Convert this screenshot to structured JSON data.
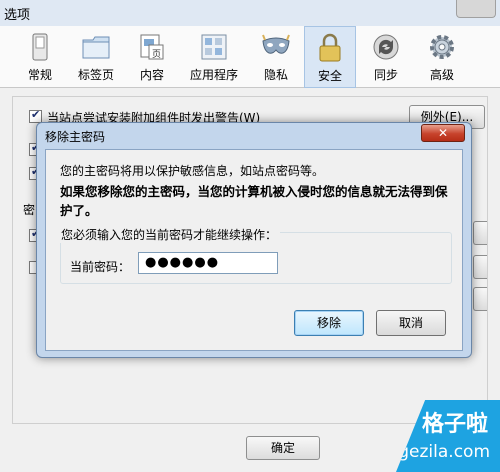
{
  "window": {
    "title": "选项"
  },
  "toolbar": {
    "items": [
      {
        "label": "常规",
        "icon": "switch-icon"
      },
      {
        "label": "标签页",
        "icon": "tabs-folder-icon"
      },
      {
        "label": "内容",
        "icon": "content-page-icon"
      },
      {
        "label": "应用程序",
        "icon": "applications-icon"
      },
      {
        "label": "隐私",
        "icon": "mask-icon"
      },
      {
        "label": "安全",
        "icon": "padlock-icon",
        "selected": true
      },
      {
        "label": "同步",
        "icon": "sync-icon"
      },
      {
        "label": "高级",
        "icon": "gear-icon"
      }
    ]
  },
  "main": {
    "addon_warning_label": "当站点尝试安装附加组件时发出警告(W)",
    "exceptions_button": "例外(E)...",
    "passwords_group_fragment": "密",
    "ok_button": "确定"
  },
  "dialog": {
    "title": "移除主密码",
    "close_symbol": "✕",
    "info_text": "您的主密码将用以保护敏感信息，如站点密码等。",
    "warning_text": "如果您移除您的主密码，当您的计算机被入侵时您的信息就无法得到保护了。",
    "group_label": "您必须输入您的当前密码才能继续操作：",
    "password_label": "当前密码：",
    "password_value": "●●●●●●",
    "remove_button": "移除",
    "cancel_button": "取消"
  },
  "watermark": {
    "brand": "格子啦",
    "url": "gezila.com"
  },
  "colors": {
    "accent": "#1ea3e1",
    "close_red": "#c7432c",
    "dialog_frame": "#c3d6ec"
  }
}
